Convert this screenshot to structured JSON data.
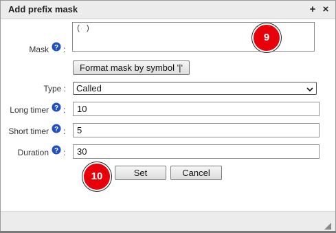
{
  "dialog": {
    "title": "Add prefix mask",
    "add_icon_glyph": "+",
    "close_icon_glyph": "×"
  },
  "form": {
    "mask": {
      "label": "Mask",
      "value": "( )"
    },
    "format_button_label": "Format mask by symbol '|'",
    "type": {
      "label": "Type :",
      "value": "Called"
    },
    "long_timer": {
      "label": "Long timer",
      "value": "10"
    },
    "short_timer": {
      "label": "Short timer",
      "value": "5"
    },
    "duration": {
      "label": "Duration",
      "value": "30"
    },
    "colon": ":"
  },
  "buttons": {
    "set_label": "Set",
    "cancel_label": "Cancel"
  },
  "markers": {
    "marker_9": "9",
    "marker_10": "10"
  },
  "colors": {
    "help_icon": "#1f4fc2",
    "marker": "#e8000a"
  }
}
